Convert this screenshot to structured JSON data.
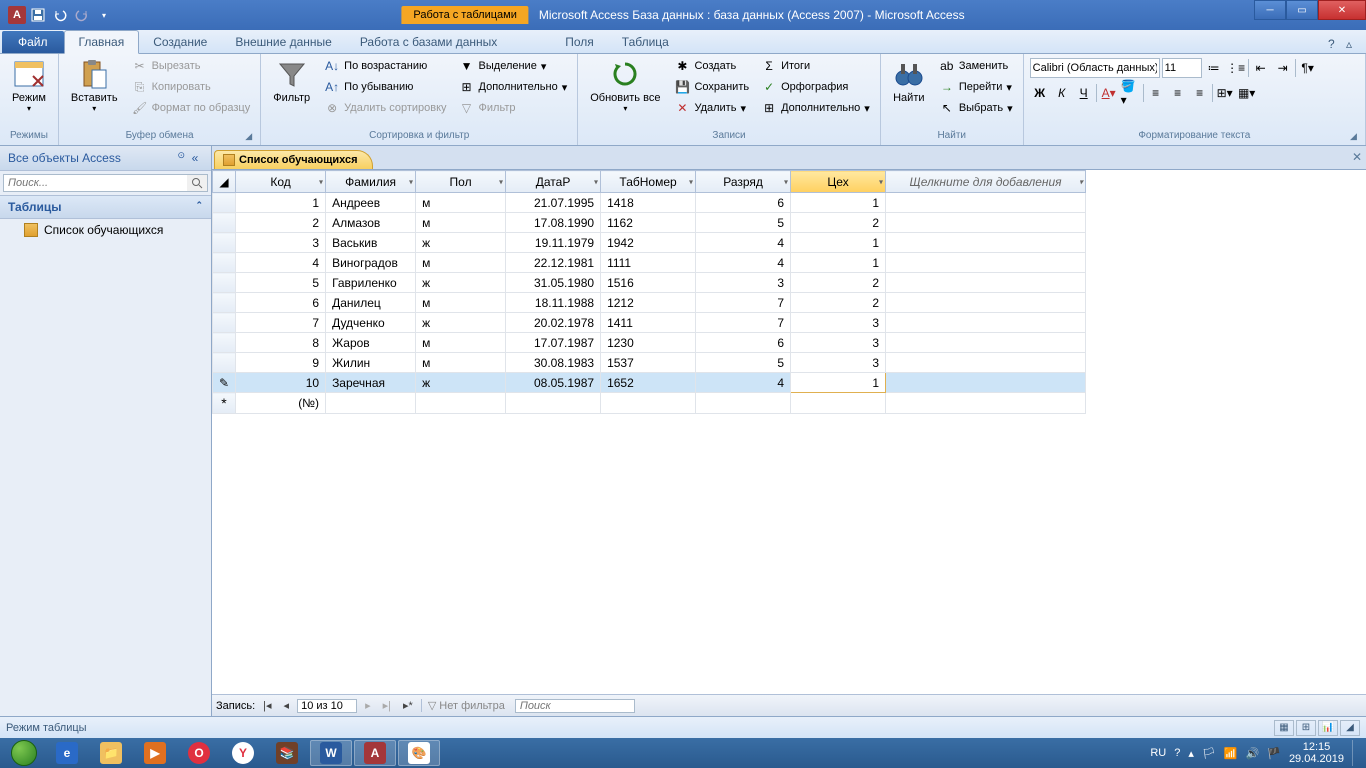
{
  "title": "Microsoft Access База данных : база данных (Access 2007)  -  Microsoft Access",
  "context_tab_group": "Работа с таблицами",
  "tabs": {
    "file": "Файл",
    "home": "Главная",
    "create": "Создание",
    "external": "Внешние данные",
    "dbtools": "Работа с базами данных",
    "fields": "Поля",
    "table": "Таблица"
  },
  "ribbon": {
    "views": {
      "mode": "Режим",
      "group": "Режимы"
    },
    "clipboard": {
      "paste": "Вставить",
      "cut": "Вырезать",
      "copy": "Копировать",
      "painter": "Формат по образцу",
      "group": "Буфер обмена"
    },
    "sort": {
      "filter": "Фильтр",
      "asc": "По возрастанию",
      "desc": "По убыванию",
      "clear": "Удалить сортировку",
      "selection": "Выделение",
      "advanced": "Дополнительно",
      "toggle": "Фильтр",
      "group": "Сортировка и фильтр"
    },
    "records": {
      "refresh": "Обновить все",
      "new": "Создать",
      "save": "Сохранить",
      "delete": "Удалить",
      "totals": "Итоги",
      "spelling": "Орфография",
      "more": "Дополнительно",
      "group": "Записи"
    },
    "find": {
      "find": "Найти",
      "replace": "Заменить",
      "goto": "Перейти",
      "select": "Выбрать",
      "group": "Найти"
    },
    "format": {
      "font": "Calibri (Область данных)",
      "size": "11",
      "group": "Форматирование текста"
    }
  },
  "nav": {
    "header": "Все объекты Access",
    "search": "Поиск...",
    "tables": "Таблицы",
    "item": "Список обучающихся"
  },
  "doc": {
    "tab": "Список обучающихся",
    "columns": [
      "Код",
      "Фамилия",
      "Пол",
      "ДатаР",
      "ТабНомер",
      "Разряд",
      "Цех"
    ],
    "add_column": "Щелкните для добавления",
    "rows": [
      {
        "id": 1,
        "fam": "Андреев",
        "pol": "м",
        "date": "21.07.1995",
        "tab": "1418",
        "raz": 6,
        "ceh": 1
      },
      {
        "id": 2,
        "fam": "Алмазов",
        "pol": "м",
        "date": "17.08.1990",
        "tab": "1162",
        "raz": 5,
        "ceh": 2
      },
      {
        "id": 3,
        "fam": "Васькив",
        "pol": "ж",
        "date": "19.11.1979",
        "tab": "1942",
        "raz": 4,
        "ceh": 1
      },
      {
        "id": 4,
        "fam": "Виноградов",
        "pol": "м",
        "date": "22.12.1981",
        "tab": "1111",
        "raz": 4,
        "ceh": 1
      },
      {
        "id": 5,
        "fam": "Гавриленко",
        "pol": "ж",
        "date": "31.05.1980",
        "tab": "1516",
        "raz": 3,
        "ceh": 2
      },
      {
        "id": 6,
        "fam": "Данилец",
        "pol": "м",
        "date": "18.11.1988",
        "tab": "1212",
        "raz": 7,
        "ceh": 2
      },
      {
        "id": 7,
        "fam": "Дудченко",
        "pol": "ж",
        "date": "20.02.1978",
        "tab": "1411",
        "raz": 7,
        "ceh": 3
      },
      {
        "id": 8,
        "fam": "Жаров",
        "pol": "м",
        "date": "17.07.1987",
        "tab": "1230",
        "raz": 6,
        "ceh": 3
      },
      {
        "id": 9,
        "fam": "Жилин",
        "pol": "м",
        "date": "30.08.1983",
        "tab": "1537",
        "raz": 5,
        "ceh": 3
      },
      {
        "id": 10,
        "fam": "Заречная",
        "pol": "ж",
        "date": "08.05.1987",
        "tab": "1652",
        "raz": 4,
        "ceh": 1
      }
    ],
    "new_placeholder": "(№)",
    "record_label": "Запись:",
    "record_pos": "10 из 10",
    "no_filter": "Нет фильтра",
    "search_ph": "Поиск"
  },
  "status": "Режим таблицы",
  "tray": {
    "lang": "RU",
    "time": "12:15",
    "date": "29.04.2019"
  }
}
